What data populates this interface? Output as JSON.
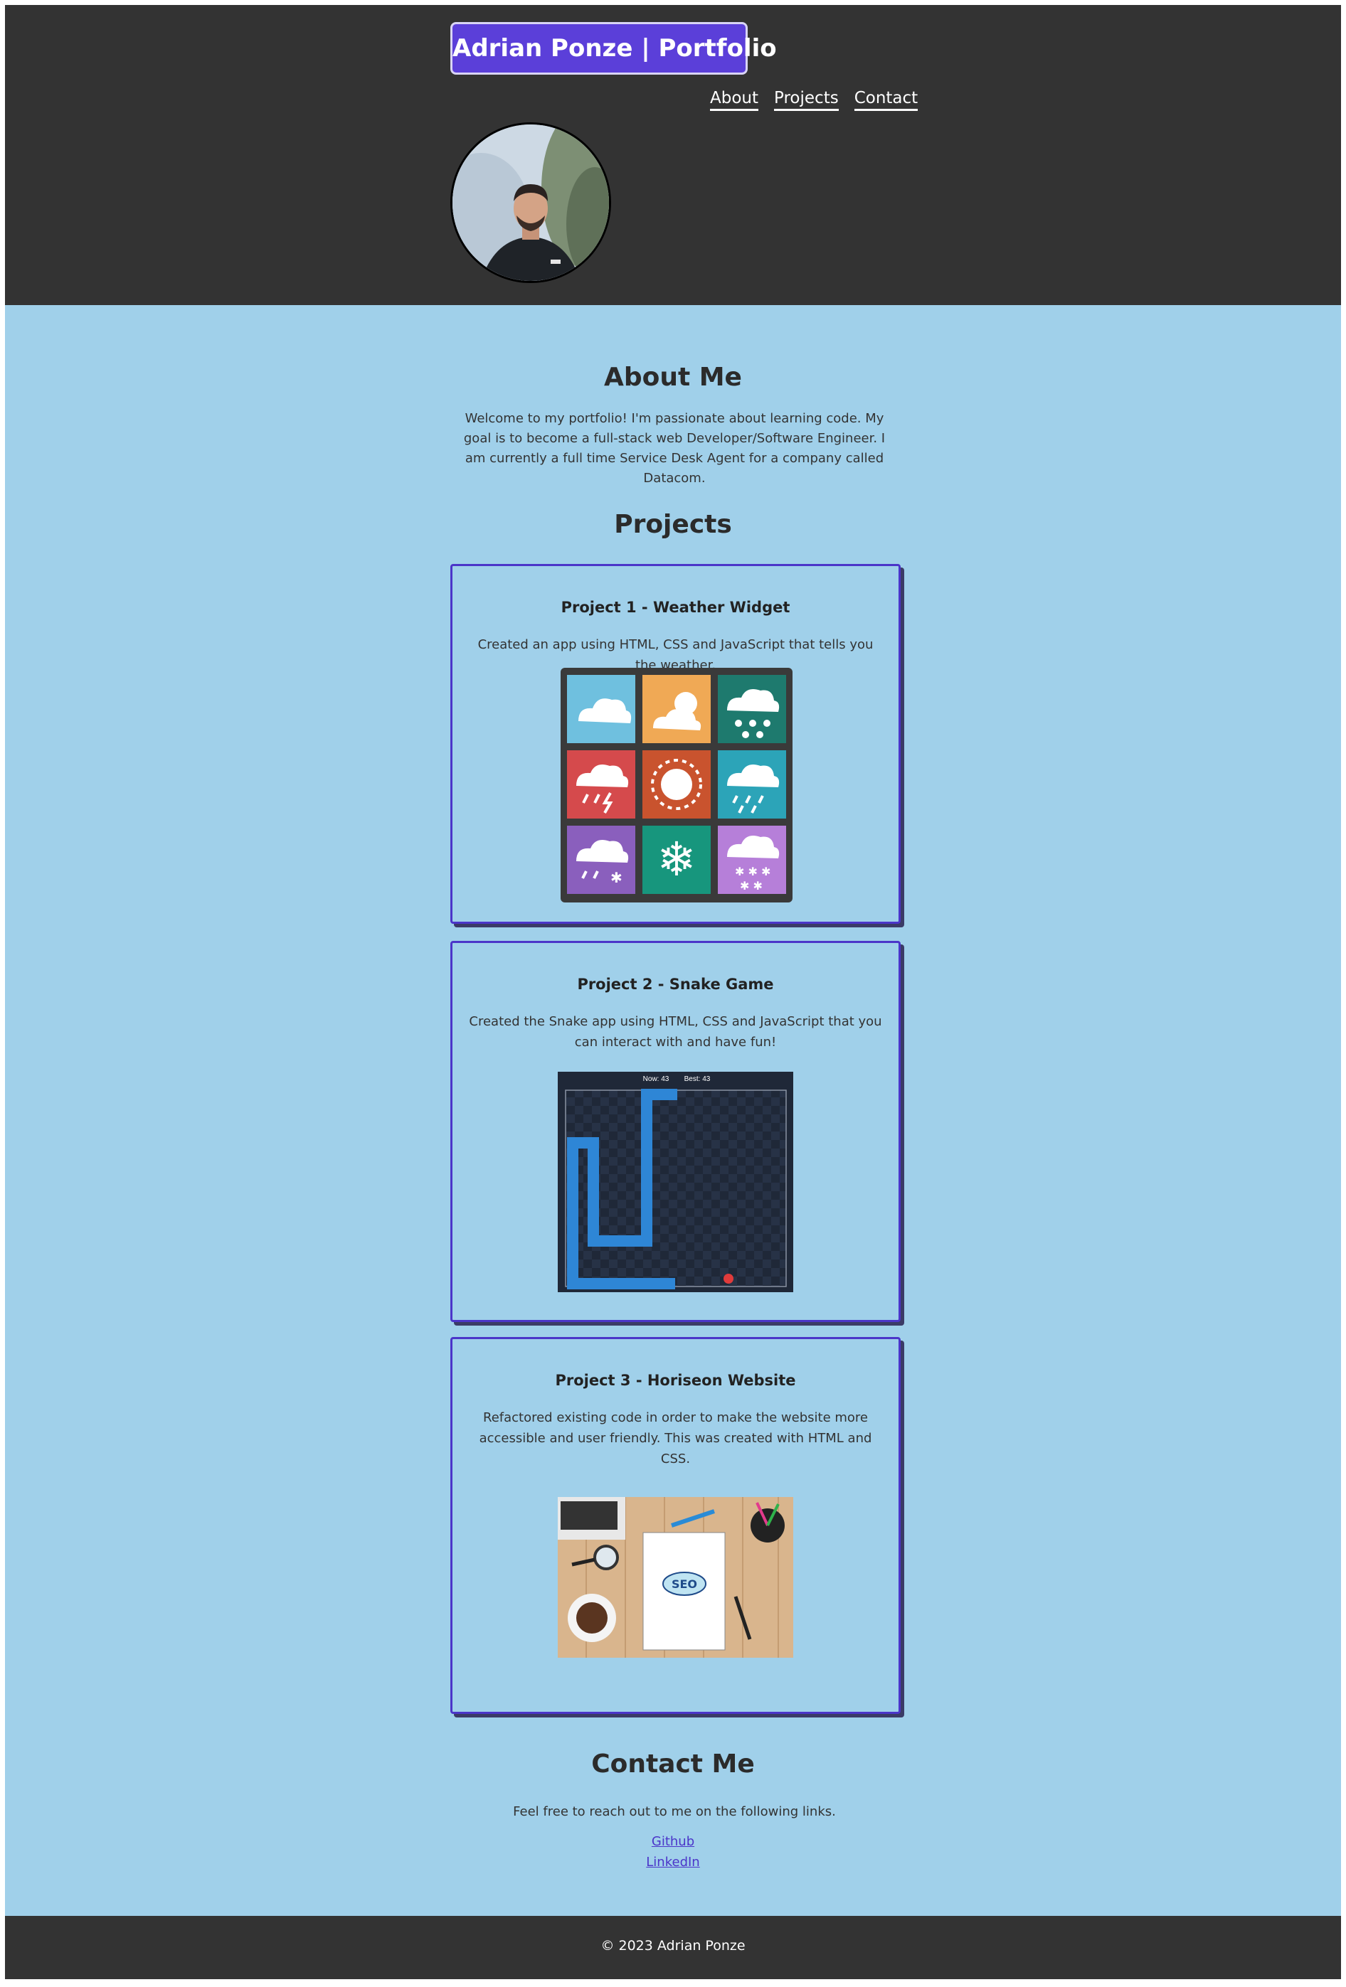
{
  "header": {
    "title": "Adrian Ponze | Portfolio",
    "nav": [
      {
        "label": "About"
      },
      {
        "label": "Projects"
      },
      {
        "label": "Contact"
      }
    ]
  },
  "about": {
    "heading": "About Me",
    "text": "Welcome to my portfolio! I'm passionate about learning code. My goal is to become a full-stack web Developer/Software Engineer. I am currently a full time Service Desk Agent for a company called Datacom."
  },
  "projects": {
    "heading": "Projects",
    "items": [
      {
        "title": "Project 1 - Weather Widget",
        "description": "Created an app using HTML, CSS and JavaScript that tells you the weather."
      },
      {
        "title": "Project 2 - Snake Game",
        "description": "Created the Snake app using HTML, CSS and JavaScript that you can interact with and have fun!",
        "score_now": "Now: 43",
        "score_best": "Best: 43"
      },
      {
        "title": "Project 3 - Horiseon Website",
        "description": "Refactored existing code in order to make the website more accessible and user friendly. This was created with HTML and CSS."
      }
    ]
  },
  "contact": {
    "heading": "Contact Me",
    "text": "Feel free to reach out to me on the following links.",
    "links": [
      {
        "label": "Github"
      },
      {
        "label": "LinkedIn"
      }
    ]
  },
  "footer": {
    "text": "© 2023 Adrian Ponze"
  },
  "colors": {
    "header_bg": "#333333",
    "page_bg": "#a0d0ea",
    "accent": "#5b3fd9",
    "card_border": "#4b35c9"
  },
  "icons": [
    "cloud-icon",
    "partly-sunny-icon",
    "hail-icon",
    "thunderstorm-icon",
    "sun-icon",
    "rain-icon",
    "sleet-icon",
    "snowflake-icon",
    "snow-icon"
  ]
}
